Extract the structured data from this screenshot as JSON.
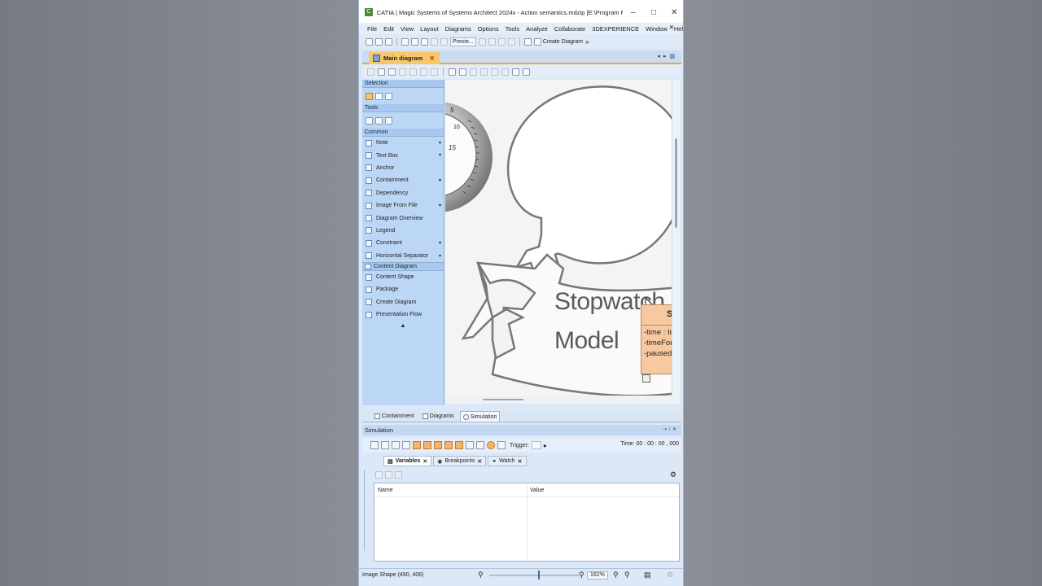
{
  "window": {
    "title": "CATIA | Magic Systems of Systems Architect 2024x - Action semantics.mdzip [E:\\Program Files\\MSOS...",
    "minimize": "–",
    "maximize": "□",
    "close": "✕"
  },
  "menu": {
    "items": [
      "File",
      "Edit",
      "View",
      "Layout",
      "Diagrams",
      "Options",
      "Tools",
      "Analyze",
      "Collaborate",
      "3DEXPERIENCE",
      "Window",
      "Help"
    ],
    "close": "✕"
  },
  "toolbar": {
    "preview_label": "Previe...",
    "create_diagram_label": "Create Diagram",
    "overflow": "»"
  },
  "diagram_tab": {
    "label": "Main diagram",
    "close": "✕",
    "nav": "◂▸▥"
  },
  "palette": {
    "selection_header": "Selection",
    "tools_header": "Tools",
    "common_header": "Common",
    "common_items": [
      {
        "label": "Note",
        "dropdown": true
      },
      {
        "label": "Text Box",
        "dropdown": true
      },
      {
        "label": "Anchor",
        "dropdown": false
      },
      {
        "label": "Containment",
        "dropdown": true
      },
      {
        "label": "Dependency",
        "dropdown": false
      },
      {
        "label": "Image From File",
        "dropdown": true
      },
      {
        "label": "Diagram Overview",
        "dropdown": false
      },
      {
        "label": "Legend",
        "dropdown": false
      },
      {
        "label": "Constraint",
        "dropdown": true
      },
      {
        "label": "Horizontal Separator",
        "dropdown": true
      }
    ],
    "content_header": "Content Diagram",
    "content_items": [
      "Content Shape",
      "Package",
      "Create Diagram",
      "Presentation Flow"
    ],
    "dropdown_glyph": "▾",
    "collapse_glyph": "▲"
  },
  "canvas": {
    "model_title_line1": "Stopwatch",
    "model_title_line2": "Model",
    "dial_numbers": [
      "5",
      "10",
      "15"
    ],
    "class_box": {
      "title": "S",
      "attrs": [
        "-time : In",
        "-timeFor",
        "-paused"
      ]
    }
  },
  "bottom_tabs": {
    "items": [
      "Containment",
      "Diagrams",
      "Simulation"
    ],
    "active": "Simulation"
  },
  "simulation": {
    "title": "Simulation",
    "header_controls": "⇢↕✕",
    "trigger_label": "Trigger:",
    "time_label": "Time: 00 : 00 : 00 , 000",
    "tabs": [
      {
        "label": "Variables",
        "close": "✕"
      },
      {
        "label": "Breakpoints",
        "close": "✕"
      },
      {
        "label": "Watch",
        "close": "✕"
      }
    ],
    "columns": [
      "Name",
      "Value"
    ],
    "gear": "⚙"
  },
  "status": {
    "text": "Image Shape (490, 406)",
    "zoom": "162%",
    "zoom_percent": 162
  },
  "colors": {
    "accent_orange": "#f9c76a",
    "class_fill": "#f7c9a0",
    "palette_bg": "#bcd6f6"
  }
}
